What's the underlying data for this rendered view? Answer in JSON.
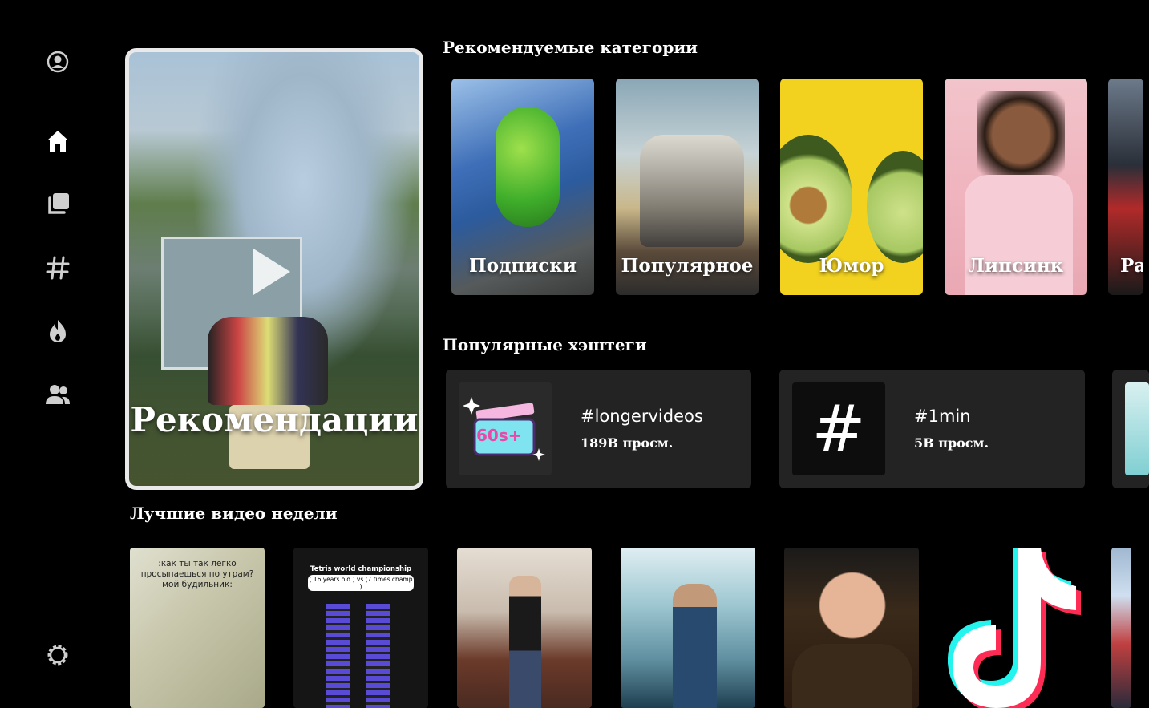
{
  "sidebar": {
    "icons": [
      "profile-icon",
      "home-icon",
      "collection-icon",
      "hashtag-icon",
      "fire-icon",
      "users-icon",
      "settings-icon"
    ]
  },
  "hero": {
    "title": "Рекомендации"
  },
  "sections": {
    "categories_title": "Рекомендуемые категории",
    "hashtags_title": "Популярные хэштеги",
    "videos_title": "Лучшие видео недели"
  },
  "categories": [
    {
      "label": "Подписки"
    },
    {
      "label": "Популярное"
    },
    {
      "label": "Юмор"
    },
    {
      "label": "Липсинк"
    },
    {
      "label": "Ра"
    }
  ],
  "hashtags": [
    {
      "tag": "#longervideos",
      "views": "189B просм.",
      "thumb_text": "60s+"
    },
    {
      "tag": "#1min",
      "views": "5B просм.",
      "thumb_text": "#"
    }
  ],
  "videos": [
    {
      "caption": ":как ты так легко просыпаешься по утрам? мой будильник:"
    },
    {
      "caption_title": "Tetris world championship",
      "caption_sub": "( 16 years old ) vs (7 times champ )"
    },
    {
      "caption": ""
    },
    {
      "caption": ""
    },
    {
      "caption": ""
    },
    {
      "caption": ""
    },
    {
      "caption": ""
    }
  ],
  "colors": {
    "background": "#000000",
    "card": "#232323",
    "hero_border": "#e9e9ea",
    "tiktok_cyan": "#25f4ee",
    "tiktok_red": "#fe2c55"
  }
}
